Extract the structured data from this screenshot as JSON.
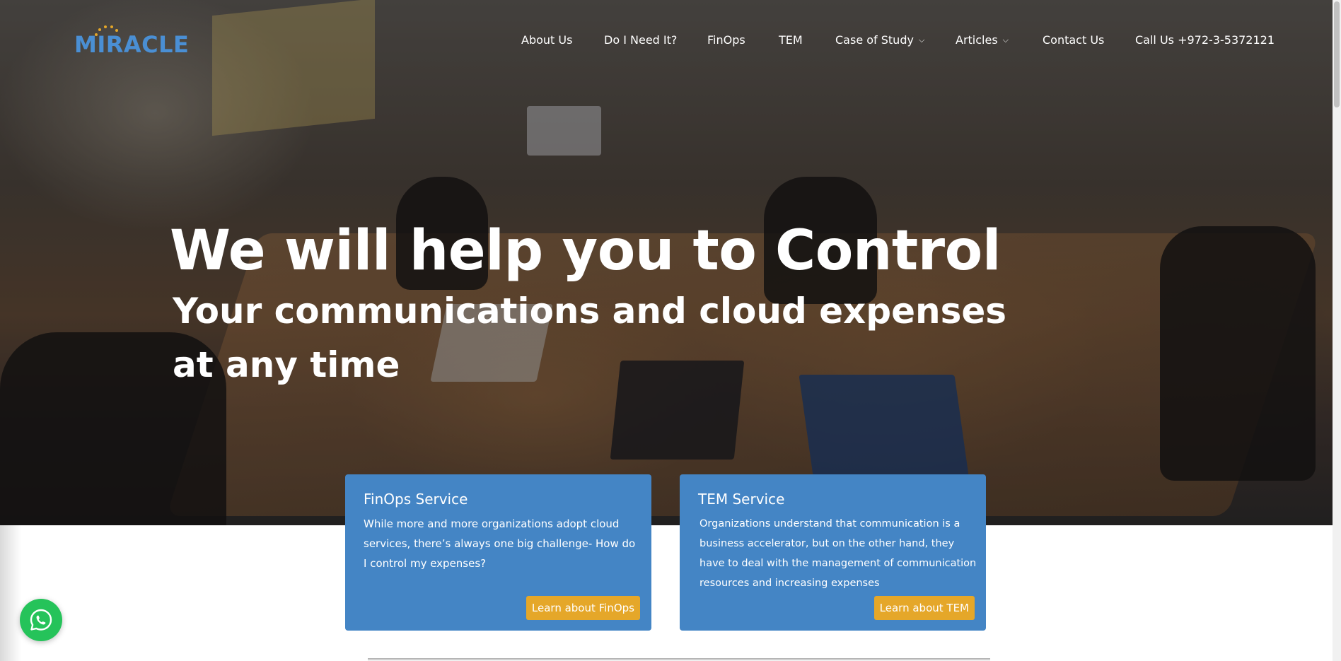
{
  "brand": {
    "logo_text": "MIRACLE",
    "color": "#4a8fd4"
  },
  "nav": {
    "items": [
      {
        "label": "About Us",
        "has_dropdown": false
      },
      {
        "label": "Do I Need It?",
        "has_dropdown": false
      },
      {
        "label": "FinOps",
        "has_dropdown": false
      },
      {
        "label": "TEM",
        "has_dropdown": false
      },
      {
        "label": "Case of Study",
        "has_dropdown": true
      },
      {
        "label": "Articles",
        "has_dropdown": true
      },
      {
        "label": "Contact Us",
        "has_dropdown": false
      },
      {
        "label": "Call Us +972-3-5372121",
        "has_dropdown": false
      }
    ]
  },
  "hero": {
    "headline": "We will help you to Control",
    "subheadline": "Your communications and cloud expenses at any time"
  },
  "cards": [
    {
      "title": "FinOps Service",
      "text": "While more and more organizations adopt cloud services, there’s always one big challenge- How do I control my expenses?",
      "button": "Learn about FinOps"
    },
    {
      "title": "TEM Service",
      "text": "Organizations understand that communication is a business accelerator, but on the other hand, they have to deal with the management of communication resources and increasing expenses",
      "button": "Learn about TEM"
    }
  ],
  "colors": {
    "card_bg": "#4485c5",
    "button_bg": "#e5a729",
    "whatsapp": "#25c35a"
  },
  "icons": {
    "whatsapp": "whatsapp-icon",
    "dropdown": "chevron-down-icon"
  }
}
